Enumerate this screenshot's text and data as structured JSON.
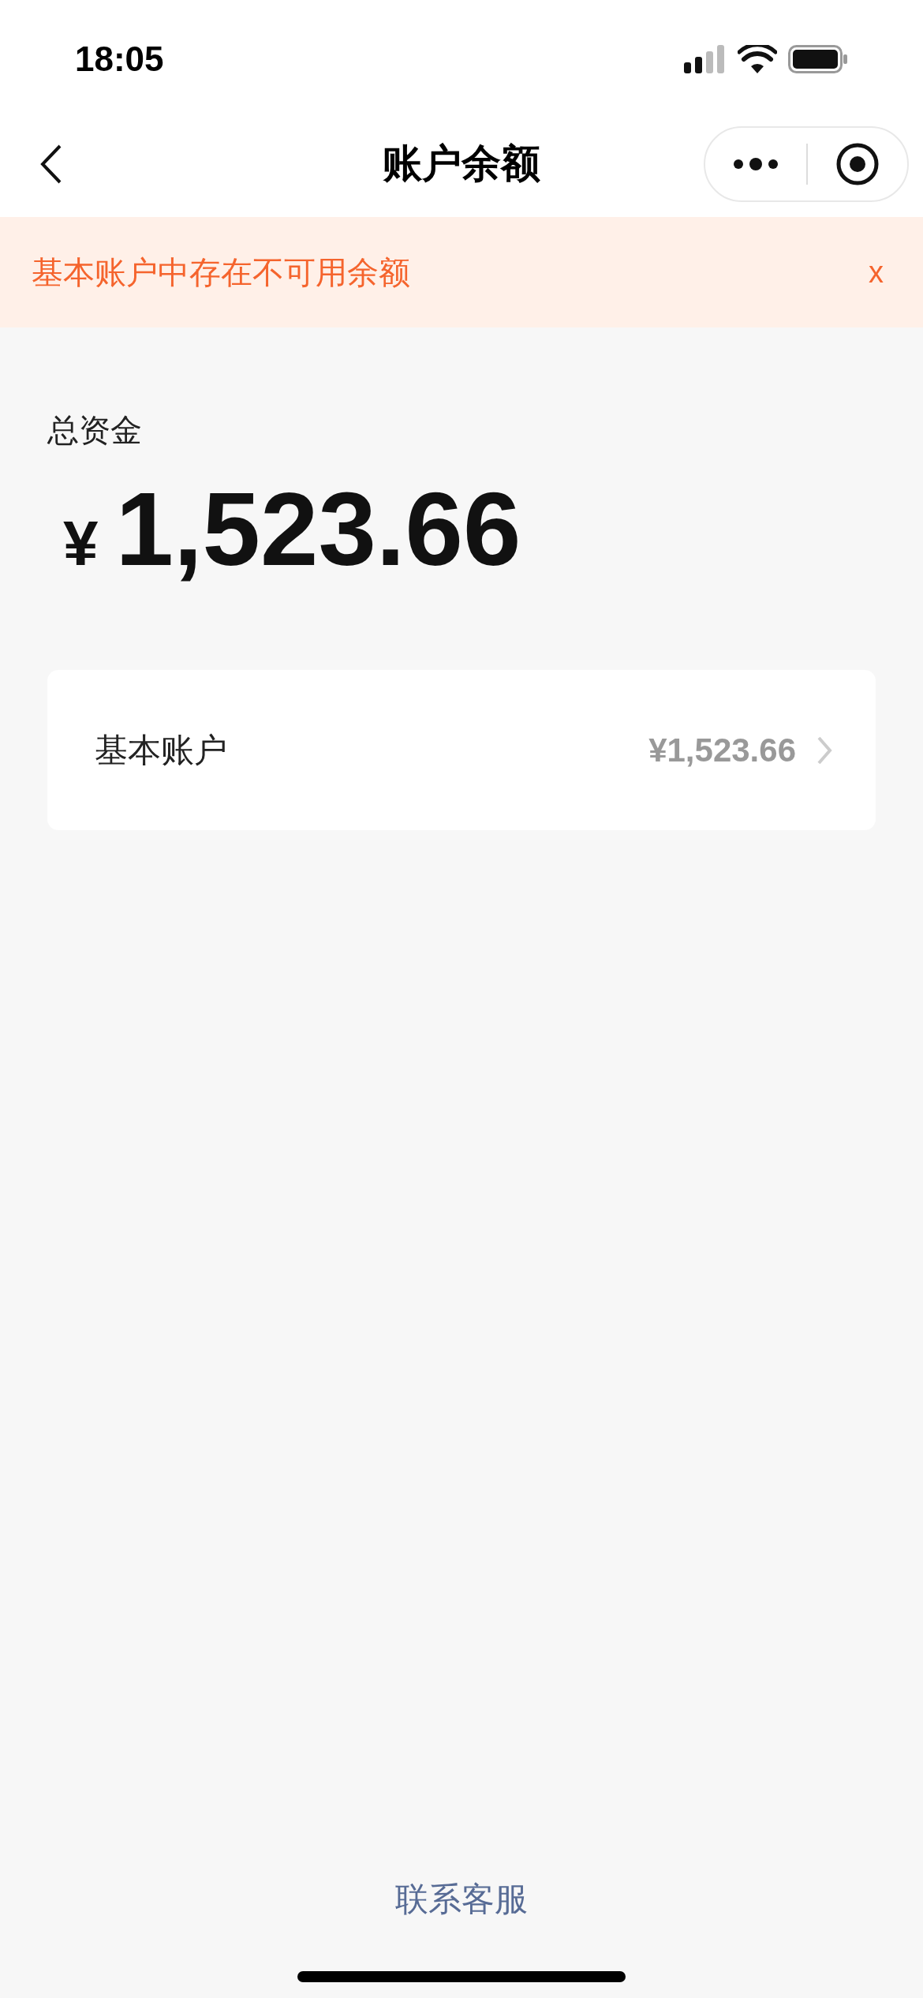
{
  "status_bar": {
    "time": "18:05"
  },
  "nav": {
    "title": "账户余额"
  },
  "notice": {
    "text": "基本账户中存在不可用余额",
    "close": "x"
  },
  "total": {
    "label": "总资金",
    "currency": "¥",
    "amount": "1,523.66"
  },
  "accounts": [
    {
      "name": "基本账户",
      "amount": "¥1,523.66"
    }
  ],
  "footer": {
    "link": "联系客服"
  }
}
